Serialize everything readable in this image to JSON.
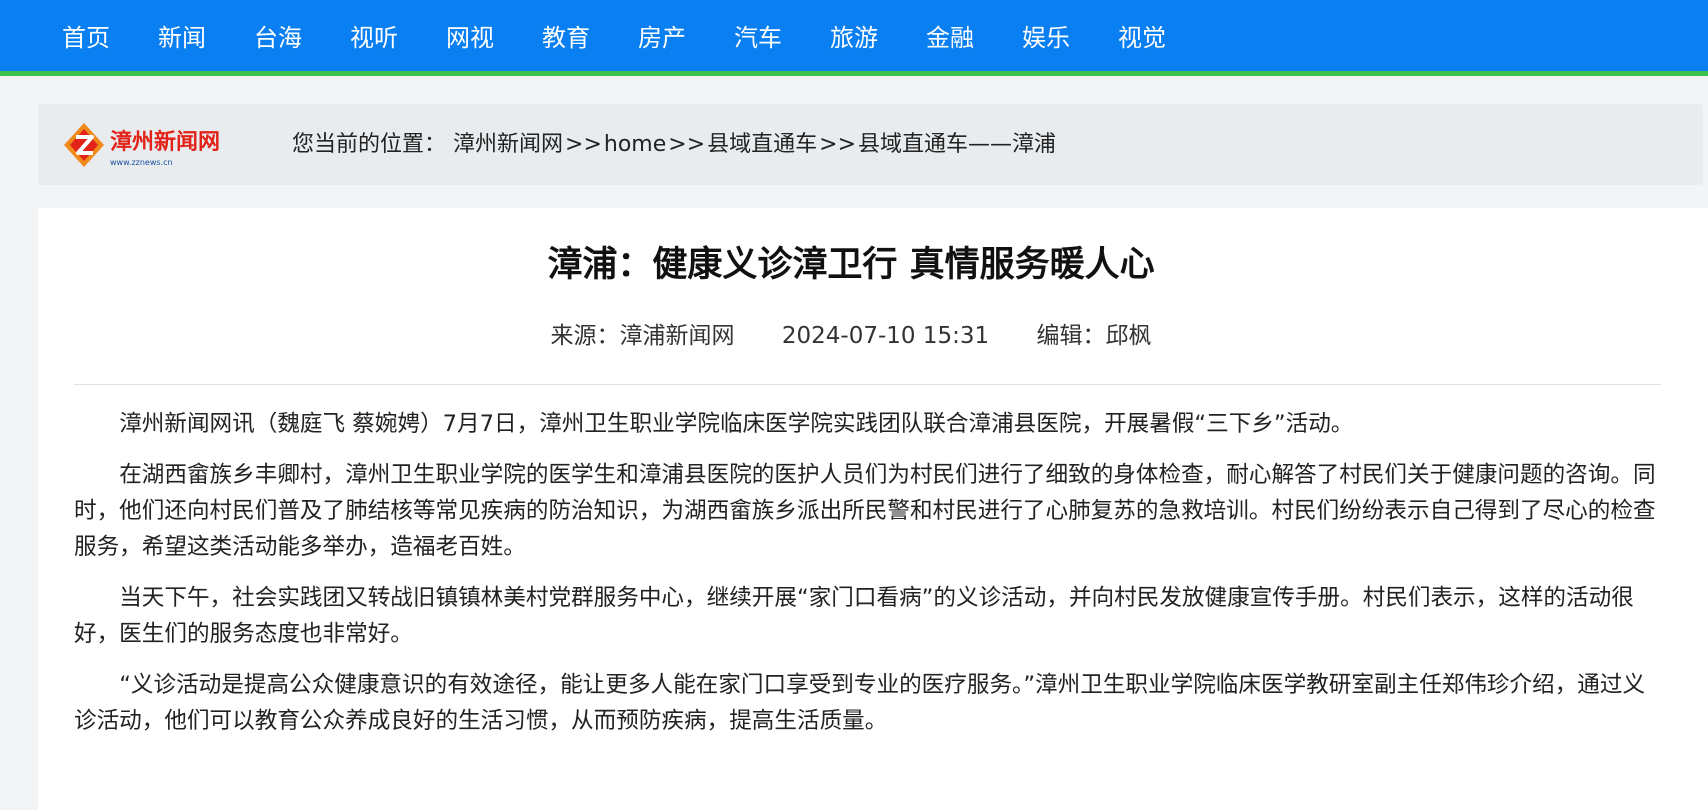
{
  "nav": {
    "items": [
      "首页",
      "新闻",
      "台海",
      "视听",
      "网视",
      "教育",
      "房产",
      "汽车",
      "旅游",
      "金融",
      "娱乐",
      "视觉"
    ]
  },
  "breadcrumb": {
    "logo_text": "漳州新闻网",
    "logo_url_text": "www.zznews.cn",
    "prefix": "您当前的位置：",
    "items": [
      "漳州新闻网",
      "home",
      "县域直通车",
      "县域直通车——漳浦"
    ],
    "separator": ">>"
  },
  "article": {
    "title": "漳浦：健康义诊漳卫行 真情服务暖人心",
    "source": "来源：漳浦新闻网",
    "datetime": "2024-07-10 15:31",
    "editor": "编辑：邱枫",
    "paragraphs": [
      "漳州新闻网讯（魏庭飞 蔡婉娉）7月7日，漳州卫生职业学院临床医学院实践团队联合漳浦县医院，开展暑假“三下乡”活动。",
      "在湖西畲族乡丰卿村，漳州卫生职业学院的医学生和漳浦县医院的医护人员们为村民们进行了细致的身体检查，耐心解答了村民们关于健康问题的咨询。同时，他们还向村民们普及了肺结核等常见疾病的防治知识，为湖西畲族乡派出所民警和村民进行了心肺复苏的急救培训。村民们纷纷表示自己得到了尽心的检查服务，希望这类活动能多举办，造福老百姓。",
      "当天下午，社会实践团又转战旧镇镇林美村党群服务中心，继续开展“家门口看病”的义诊活动，并向村民发放健康宣传手册。村民们表示，这样的活动很好，医生们的服务态度也非常好。",
      "“义诊活动是提高公众健康意识的有效途径，能让更多人能在家门口享受到专业的医疗服务。”漳州卫生职业学院临床医学教研室副主任郑伟珍介绍，通过义诊活动，他们可以教育公众养成良好的生活习惯，从而预防疾病，提高生活质量。"
    ]
  },
  "colors": {
    "nav_bg": "#0a7ff2",
    "nav_underline": "#3fbf4c",
    "crumb_bg": "#e9ecef",
    "page_bg": "#f2f4f6"
  }
}
